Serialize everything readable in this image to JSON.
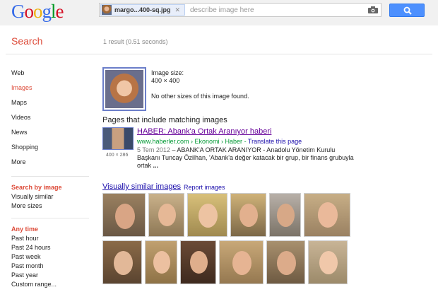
{
  "header": {
    "logo": "Google",
    "query_file": "margo...400-sq.jpg",
    "placeholder": "describe image here",
    "colors": {
      "blue": "#3369e8",
      "red": "#d50f25",
      "yellow": "#eeb211",
      "green": "#009925",
      "button": "#4d90fe"
    }
  },
  "search_title": "Search",
  "result_count": "1 result (0.51 seconds)",
  "nav": [
    "Web",
    "Images",
    "Maps",
    "Videos",
    "News",
    "Shopping",
    "More"
  ],
  "nav_selected": "Images",
  "search_by_image": {
    "title": "Search by image",
    "options": [
      "Visually similar",
      "More sizes"
    ]
  },
  "any_time": {
    "title": "Any time",
    "options": [
      "Past hour",
      "Past 24 hours",
      "Past week",
      "Past month",
      "Past year",
      "Custom range..."
    ]
  },
  "query_image": {
    "size_label": "Image size:",
    "size_value": "400 × 400",
    "no_other": "No other sizes of this image found."
  },
  "pages": {
    "heading": "Pages that include matching images",
    "result": {
      "title": "HABER: Abank'a Ortak Aranıyor haberi",
      "url": "www.haberler.com › Ekonomi › Haber",
      "translate": "Translate this page",
      "date": "5 Tem 2012",
      "snippet_1": " – ABANK'A ORTAK ARANIYOR - Anadolu Yönetim Kurulu",
      "snippet_2": "Başkanı Tuncay Özilhan, 'Abank'a değer katacak bir grup, bir finans grubuyla",
      "snippet_3": "ortak",
      "snippet_4": " ...",
      "thumb_size": "400 × 286"
    }
  },
  "similar": {
    "heading": "Visually similar images",
    "report": "Report images"
  }
}
